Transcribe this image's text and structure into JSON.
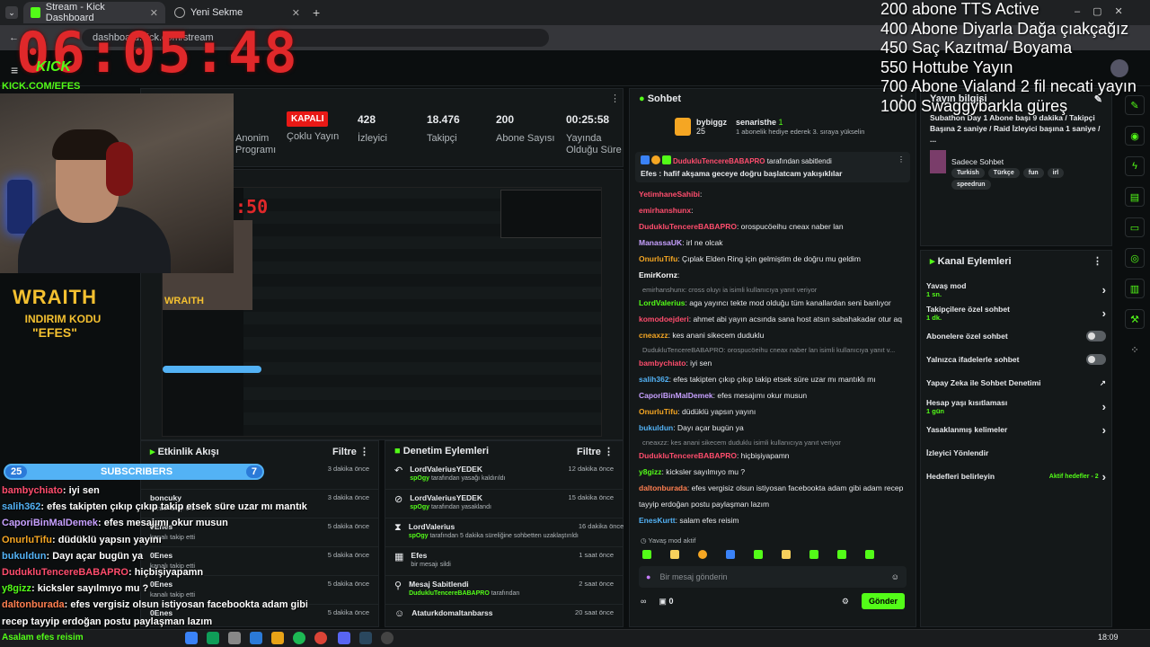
{
  "browser": {
    "tabs": [
      {
        "title": "Stream - Kick Dashboard"
      },
      {
        "title": "Yeni Sekme"
      }
    ],
    "url": "dashboard.kick.com/stream"
  },
  "overlay": {
    "clock": "06:05:48",
    "brand_logo": "KICK",
    "brand_url": "KICK.COM/EFES",
    "sponsor_name": "WRAITH",
    "sponsor_line": "INDIRIM KODU",
    "sponsor_code": "\"EFES\"",
    "goals": [
      "200 abone TTS Active",
      "400 Abone Diyarla Dağa çıakçağız",
      "450 Saç Kazıtma/ Boyama",
      "550 Hottube Yayın",
      "700 Abone Vialand 2 fil necati yayın",
      "1000 Swaggybarkla güreş"
    ],
    "sub_counter": {
      "left": "25",
      "label": "SUBSCRIBERS",
      "right": "7"
    },
    "chat": [
      {
        "user": "bambychiato",
        "text": ": iyi sen",
        "color": "#ff4d6d"
      },
      {
        "user": "salih362",
        "text": ": efes takipten çıkıp çıkıp takip etsek süre uzar mı mantıklı mı",
        "color": "#53b2f5"
      },
      {
        "user": "CaporiBinMalDemek",
        "text": ": efes mesajımı okur musun",
        "color": "#c7a0ff"
      },
      {
        "user": "OnurluTifu",
        "text": ": düdüklü yapsın yayını",
        "color": "#f5a623"
      },
      {
        "user": "bukuldun",
        "text": ": Dayı açar bugün ya",
        "color": "#53b2f5"
      },
      {
        "user": "DudukluTencereBABAPRO",
        "text": ": hiçbişiyapamn",
        "color": "#ff4d6d"
      },
      {
        "user": "y8gizz",
        "text": ": kicksler sayılmıyo mu ?",
        "color": "#53fc18"
      },
      {
        "user": "daltonburada",
        "text": ": efes vergisiz olsun istiyosan facebookta adam gibi adam",
        "color": "#ff7f50"
      },
      {
        "user": "",
        "text": "recep tayyip erdoğan postu paylaşman lazım",
        "color": "#ffffff"
      }
    ],
    "bottom_chat": "Asalam efes reisim"
  },
  "stats": [
    {
      "value": "",
      "label": "Anonim Programı",
      "partial": true
    },
    {
      "badge": "KAPALI",
      "label": "Çoklu Yayın"
    },
    {
      "value": "428",
      "label": "İzleyici"
    },
    {
      "value": "18.476",
      "label": "Takipçi"
    },
    {
      "value": "200",
      "label": "Abone Sayısı"
    },
    {
      "value": "00:25:58",
      "label": "Yayında Olduğu Süre"
    }
  ],
  "preview_timer": ":50",
  "activity": {
    "title": "Etkinlik Akışı",
    "filter": "Filtre",
    "items": [
      {
        "name": "",
        "desc": "kanalı takip etti",
        "time": "3 dakika önce"
      },
      {
        "name": "boncuky",
        "desc": "kanalı takip etti",
        "time": "3 dakika önce"
      },
      {
        "name": "0Enes",
        "desc": "kanalı takip etti",
        "time": "5 dakika önce"
      },
      {
        "name": "0Enes",
        "desc": "kanalı takip etti",
        "time": "5 dakika önce"
      },
      {
        "name": "0Enes",
        "desc": "kanalı takip etti",
        "time": "5 dakika önce"
      },
      {
        "name": "0Enes",
        "desc": "",
        "time": "5 dakika önce"
      }
    ]
  },
  "moderation": {
    "title": "Denetim Eylemleri",
    "filter": "Filtre",
    "items": [
      {
        "name": "LordValeriusYEDEK",
        "by": "spOgy",
        "desc": "tarafından yasağı kaldırıldı",
        "time": "12 dakika önce",
        "icon": "undo-icon"
      },
      {
        "name": "LordValeriusYEDEK",
        "by": "spOgy",
        "desc": "tarafından yasaklandı",
        "time": "15 dakika önce",
        "icon": "ban-icon"
      },
      {
        "name": "LordValerius",
        "by": "spOgy",
        "desc": "tarafından 5 dakika süreliğine sohbetten uzaklaştırıldı",
        "time": "16 dakika önce",
        "icon": "hourglass-icon"
      },
      {
        "name": "Efes",
        "by": "",
        "desc": "bir mesajı sildi",
        "time": "1 saat önce",
        "icon": "trash-icon"
      },
      {
        "name": "Mesaj Sabitlendi",
        "by": "DudukluTencereBABAPRO",
        "desc": "tarafından",
        "time": "2 saat önce",
        "icon": "pin-icon"
      },
      {
        "name": "Ataturkdomaltanbarss",
        "by": "",
        "desc": "",
        "time": "20 saat önce",
        "icon": "user-icon"
      }
    ]
  },
  "chat": {
    "title": "Sohbet",
    "top_gifter": {
      "name": "bybiggz",
      "count": "25",
      "recipient": "senaristhe",
      "recipient_count": "1",
      "note": "1 abonelik hediye ederek 3. sıraya yükselin"
    },
    "pinned": {
      "by": "DudukluTencereBABAPRO",
      "by_suffix": "tarafından sabitlendi",
      "text": "Efes : hafif akşama geceye doğru başlatcam yakışıklılar"
    },
    "messages": [
      {
        "user": "YetimhaneSahibi",
        "text": ":",
        "color": "#ff4d6d"
      },
      {
        "user": "emirhanshunx",
        "text": ":",
        "color": "#ff4d6d"
      },
      {
        "user": "DudukluTencereBABAPRO",
        "text": ": orospucöeihu cneax naber lan",
        "color": "#ff4d6d"
      },
      {
        "user": "ManassaUK",
        "text": ": irl ne olcak",
        "color": "#c7a0ff"
      },
      {
        "user": "OnurluTifu",
        "text": ": Çıplak Elden Ring için gelmiştim de doğru mu geldim",
        "color": "#f5a623"
      },
      {
        "user": "EmirKornz",
        "text": ":",
        "color": "#ffffff"
      },
      {
        "user": "",
        "text": "emirhanshunx: cross oluyı ia isimli kullanıcıya yanıt veriyor",
        "color": "#8a8f93",
        "reply": true
      },
      {
        "user": "LordValerius",
        "text": ": aga yayıncı tekte mod olduğu tüm kanallardan seni banlıyor",
        "color": "#53fc18"
      },
      {
        "user": "komodoejderi",
        "text": ": ahmet abi yayın acsında sana host atsın sabahakadar otur aq",
        "color": "#ff4d6d"
      },
      {
        "user": "cneaxzz",
        "text": ": kes anani sikecem duduklu",
        "color": "#f5a623"
      },
      {
        "user": "",
        "text": "DudukluTencereBABAPRO: orospucöeihu cneax naber lan isimli kullanıcıya yanıt v...",
        "color": "#8a8f93",
        "reply": true
      },
      {
        "user": "bambychiato",
        "text": ": iyi sen",
        "color": "#ff4d6d"
      },
      {
        "user": "salih362",
        "text": ": efes takipten çıkıp çıkıp takip etsek süre uzar mı mantıklı mı",
        "color": "#53b2f5"
      },
      {
        "user": "CaporiBinMalDemek",
        "text": ": efes mesajımı okur musun",
        "color": "#c7a0ff"
      },
      {
        "user": "OnurluTifu",
        "text": ": düdüklü yapsın yayını",
        "color": "#f5a623"
      },
      {
        "user": "bukuldun",
        "text": ": Dayı açar bugün ya",
        "color": "#53b2f5"
      },
      {
        "user": "",
        "text": "cneaxzz: kes anani sikecem duduklu isimli kullanıcıya yanıt veriyor",
        "color": "#8a8f93",
        "reply": true
      },
      {
        "user": "DudukluTencereBABAPRO",
        "text": ": hiçbişiyapamn",
        "color": "#ff4d6d"
      },
      {
        "user": "y8gizz",
        "text": ": kicksler sayılmıyo mu ?",
        "color": "#53fc18"
      },
      {
        "user": "daltonburada",
        "text": ": efes vergisiz olsun istiyosan facebookta adam gibi adam recep",
        "color": "#ff7f50"
      },
      {
        "user": "",
        "text": "tayyip erdoğan postu paylaşman lazım",
        "color": "#ffffff"
      },
      {
        "user": "EnesKurtt",
        "text": ": salam efes reisim",
        "color": "#53b2f5"
      }
    ],
    "slow_mode": "Yavaş mod aktif",
    "input_placeholder": "Bir mesaj gönderin",
    "kicks": "0",
    "send": "Gönder"
  },
  "stream_info": {
    "title": "Yayın bilgisi",
    "description": "Subathon Day 1 Abone başı 9 dakika / Takipçi Başına 2 saniye / Raid İzleyici başına 1 saniye / ...",
    "category": "Sadece Sohbet",
    "tags": [
      "Turkish",
      "Türkçe",
      "fun",
      "irl",
      "speedrun"
    ]
  },
  "channel_actions": {
    "title": "Kanal Eylemleri",
    "rows": [
      {
        "label": "Yavaş mod",
        "sub": "1 sn.",
        "control": "chevron"
      },
      {
        "label": "Takipçilere özel sohbet",
        "sub": "1 dk.",
        "control": "chevron"
      },
      {
        "label": "Abonelere özel sohbet",
        "sub": "",
        "control": "toggle"
      },
      {
        "label": "Yalnızca ifadelerle sohbet",
        "sub": "",
        "control": "toggle"
      },
      {
        "label": "Yapay Zeka ile Sohbet Denetimi",
        "sub": "",
        "control": "external"
      },
      {
        "label": "Hesap yaşı kısıtlaması",
        "sub": "1 gün",
        "control": "chevron"
      },
      {
        "label": "Yasaklanmış kelimeler",
        "sub": "",
        "control": "chevron"
      },
      {
        "label": "İzleyici Yönlendir",
        "sub": "",
        "control": ""
      },
      {
        "label": "Hedefleri belirleyin",
        "sub": "Aktif hedefler - 2",
        "control": "chevron"
      }
    ]
  },
  "taskbar": {
    "time": "18:09"
  },
  "colors": {
    "accent": "#53fc18",
    "live_red": "#e91916",
    "clock_red": "#e0282a",
    "sub_blue": "#53b2f5"
  }
}
